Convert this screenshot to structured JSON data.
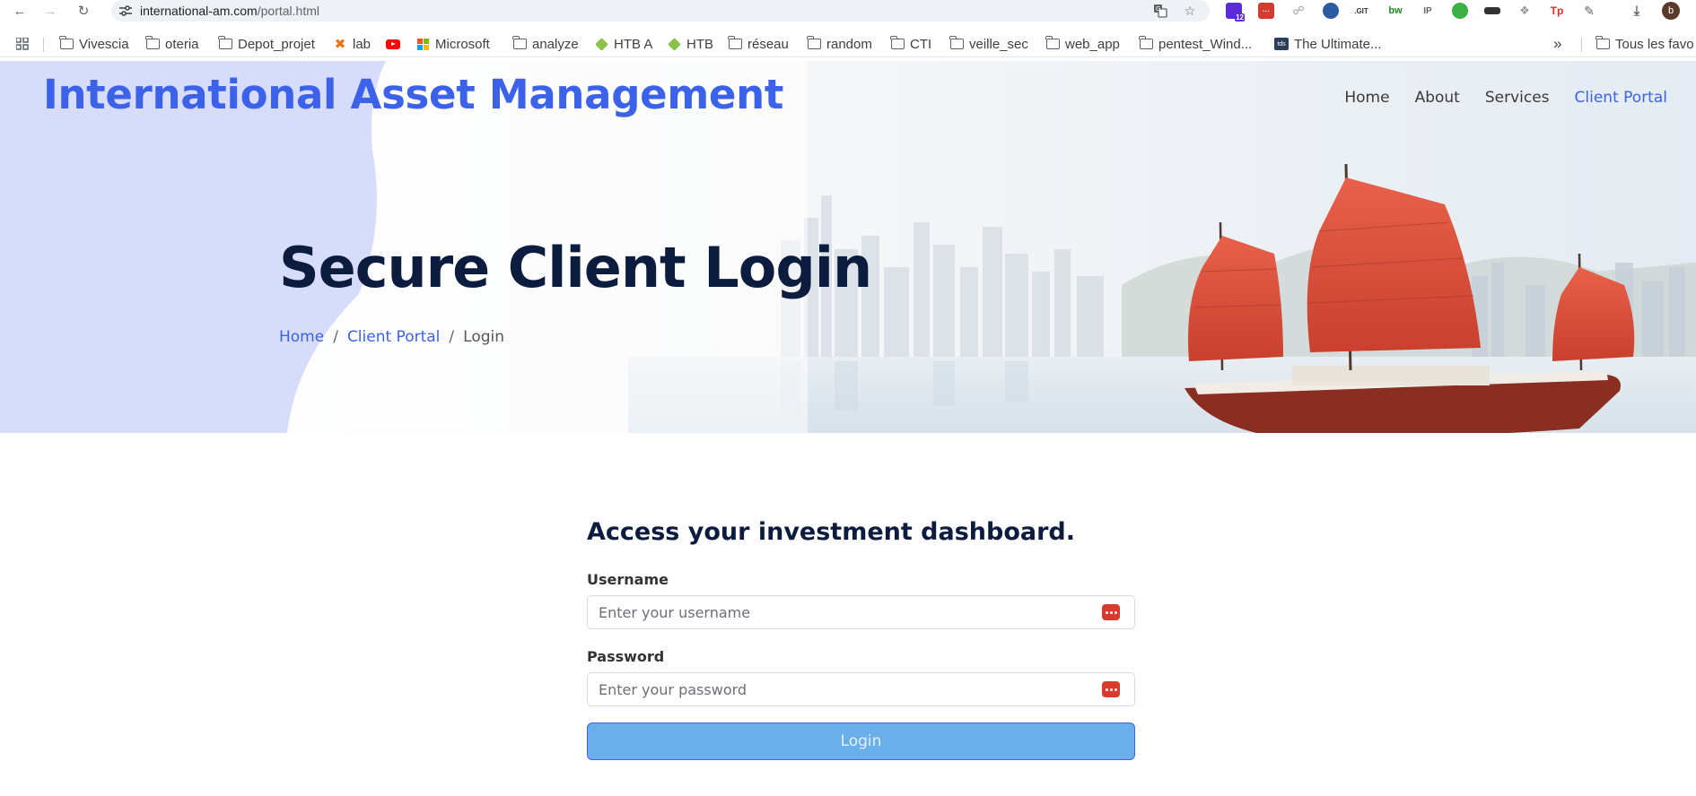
{
  "browser": {
    "url_host": "international-am.com",
    "url_path": "/portal.html",
    "avatar_letter": "b",
    "ext_badge": "12",
    "bookmarks": [
      {
        "label": "Vivescia",
        "icon": "folder-icon"
      },
      {
        "label": "oteria",
        "icon": "folder-icon"
      },
      {
        "label": "Depot_projet",
        "icon": "folder-icon"
      },
      {
        "label": "lab",
        "icon": "x-logo-icon"
      },
      {
        "label": "",
        "icon": "youtube-icon"
      },
      {
        "label": "Microsoft",
        "icon": "microsoft-icon"
      },
      {
        "label": "analyze",
        "icon": "folder-icon"
      },
      {
        "label": "HTB A",
        "icon": "htb-cube-icon"
      },
      {
        "label": "HTB",
        "icon": "htb-cube-icon"
      },
      {
        "label": "réseau",
        "icon": "folder-icon"
      },
      {
        "label": "random",
        "icon": "folder-icon"
      },
      {
        "label": "CTI",
        "icon": "folder-icon"
      },
      {
        "label": "veille_sec",
        "icon": "folder-icon"
      },
      {
        "label": "web_app",
        "icon": "folder-icon"
      },
      {
        "label": "pentest_Wind...",
        "icon": "folder-icon"
      },
      {
        "label": "The Ultimate...",
        "icon": "tds-icon"
      }
    ],
    "overflow_label": "»",
    "all_bookmarks_label": "Tous les favo"
  },
  "site": {
    "brand": "International Asset Management",
    "nav": [
      "Home",
      "About",
      "Services",
      "Client Portal"
    ],
    "active_nav": "Client Portal",
    "accent_color": "#3b62e8",
    "title_color": "#0c1c3e"
  },
  "hero": {
    "title": "Secure Client Login",
    "breadcrumb": [
      "Home",
      "Client Portal",
      "Login"
    ]
  },
  "login": {
    "heading": "Access your investment dashboard.",
    "username_label": "Username",
    "username_placeholder": "Enter your username",
    "password_label": "Password",
    "password_placeholder": "Enter your password",
    "submit_label": "Login",
    "button_color": "#6aaeea"
  }
}
